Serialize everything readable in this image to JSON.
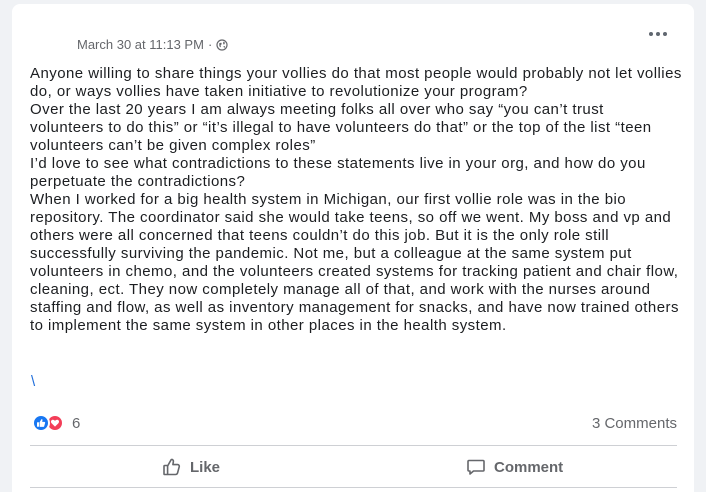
{
  "post": {
    "timestamp": "March 30 at 11:13 PM",
    "separator": "·",
    "audience_icon": "globe-icon",
    "more_icon": "more-options-icon",
    "body_paragraphs": [
      "Anyone willing to share things your vollies do that most people would probably not let vollies do, or ways vollies have taken initiative to revolutionize your program?",
      "Over the last 20 years I am always meeting folks all over who say “you can’t trust volunteers to do this” or “it’s illegal to have volunteers do that” or the top of the list “teen volunteers can’t be given complex roles”",
      "I’d love to see what contradictions to these statements live in your org, and how do you perpetuate the contradictions?",
      "When I worked for a big health system in Michigan, our first vollie role was in the bio repository. The coordinator said she would take teens, so off we went. My boss and vp and others were all concerned that teens couldn’t do this job. But it is the only role still successfully surviving the pandemic. Not me, but a colleague at the same system put volunteers in chemo, and the volunteers created systems for tracking patient and chair flow, cleaning, ect. They now completely manage all of that, and work with the nurses around staffing and flow, as well as inventory management for snacks, and have now trained others to implement the same system in other places in the health system."
    ],
    "trailing_link": "\\"
  },
  "reactions": {
    "icons": [
      "like-reaction-icon",
      "love-reaction-icon"
    ],
    "count": "6",
    "comments_label": "3 Comments"
  },
  "actions": {
    "like_label": "Like",
    "comment_label": "Comment"
  },
  "colors": {
    "like_blue": "#1877f2",
    "love_red": "#f33e58",
    "link_blue": "#216fdb",
    "secondary_text": "#65676b"
  }
}
